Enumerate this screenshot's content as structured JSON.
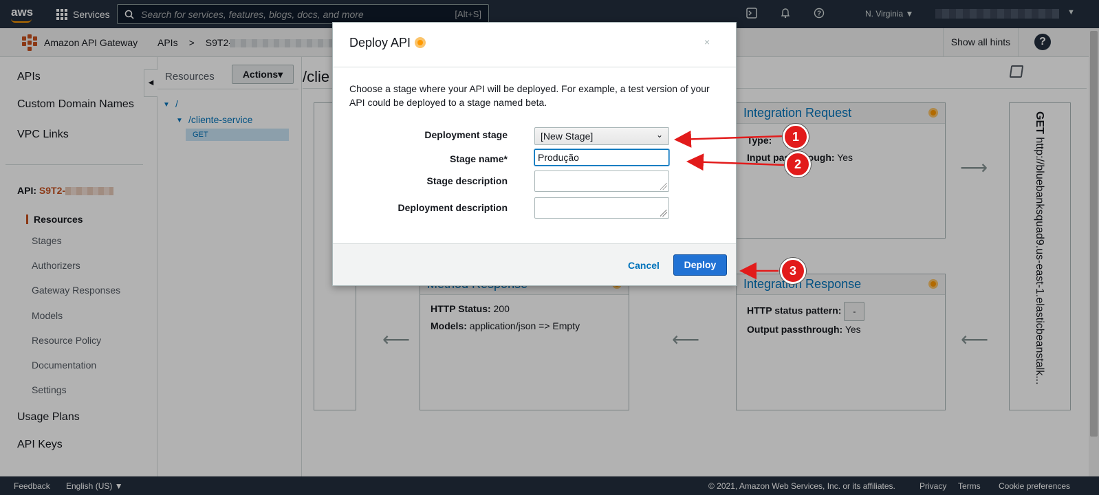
{
  "topnav": {
    "logo": "aws",
    "services_label": "Services",
    "search_placeholder": "Search for services, features, blogs, docs, and more",
    "search_shortcut": "[Alt+S]",
    "region": "N. Virginia ▼"
  },
  "subnav": {
    "service_name": "Amazon API Gateway",
    "crumb_apis": "APIs",
    "crumb_sep": ">",
    "crumb_api": "S9T2-",
    "show_hints": "Show all hints",
    "help": "?"
  },
  "leftnav": {
    "apis": "APIs",
    "custom_domains": "Custom Domain Names",
    "vpc_links": "VPC Links",
    "api_prefix": "API:",
    "api_name": "S9T2-",
    "items": [
      "Resources",
      "Stages",
      "Authorizers",
      "Gateway Responses",
      "Models",
      "Resource Policy",
      "Documentation",
      "Settings"
    ],
    "usage_plans": "Usage Plans",
    "api_keys": "API Keys"
  },
  "resources": {
    "title": "Resources",
    "actions": "Actions▾",
    "root": "/",
    "child": "/cliente-service",
    "method": "GET"
  },
  "main": {
    "path": "/clie",
    "integration_request": {
      "title": "Integration Request",
      "type_label": "Type:",
      "passthrough_label": "Input passthrough:",
      "passthrough_value": "Yes"
    },
    "method_response": {
      "title": "Method Response",
      "status_label": "HTTP Status:",
      "status_value": "200",
      "models_label": "Models:",
      "models_value": "application/json => Empty"
    },
    "integration_response": {
      "title": "Integration Response",
      "pattern_label": "HTTP status pattern:",
      "pattern_value": "-",
      "passthrough_label": "Output passthrough:",
      "passthrough_value": "Yes"
    },
    "endpoint_method": "GET",
    "endpoint_url": "http://bluebanksquad9.us-east-1.elasticbeanstalk..."
  },
  "modal": {
    "title": "Deploy API",
    "close": "×",
    "description": "Choose a stage where your API will be deployed. For example, a test version of your API could be deployed to a stage named beta.",
    "deployment_stage_label": "Deployment stage",
    "deployment_stage_value": "[New Stage]",
    "stage_name_label": "Stage name*",
    "stage_name_value": "Produção",
    "stage_description_label": "Stage description",
    "deployment_description_label": "Deployment description",
    "cancel": "Cancel",
    "deploy": "Deploy"
  },
  "annotations": [
    "1",
    "2",
    "3"
  ],
  "footer": {
    "feedback": "Feedback",
    "language": "English (US) ▼",
    "copyright": "© 2021, Amazon Web Services, Inc. or its affiliates.",
    "privacy": "Privacy",
    "terms": "Terms",
    "cookies": "Cookie preferences"
  },
  "colors": {
    "nav_bg": "#232f3e",
    "accent": "#c7511f",
    "link": "#0073bb",
    "primary_button": "#2172d4",
    "annotation": "#e21b1b"
  }
}
